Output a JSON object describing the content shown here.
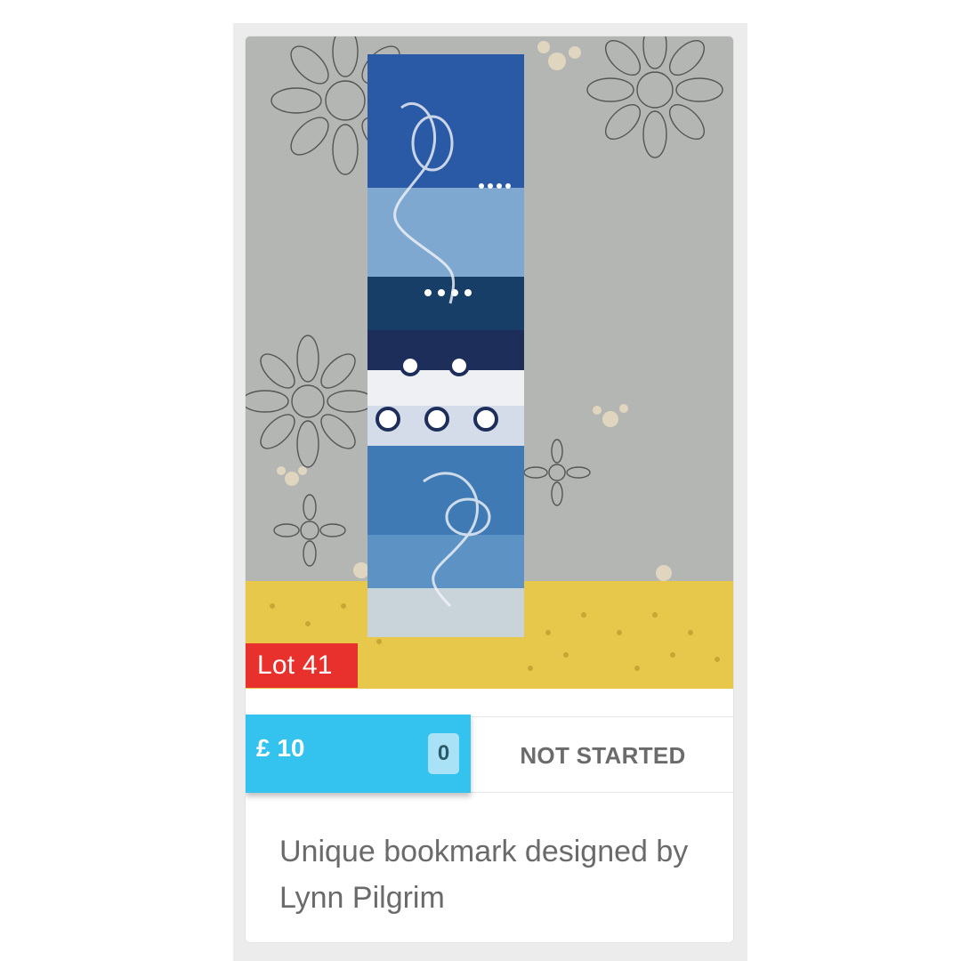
{
  "lot": {
    "label": "Lot 41"
  },
  "price": {
    "value": "£ 10"
  },
  "bids": {
    "count": "0"
  },
  "status": {
    "label": "NOT STARTED"
  },
  "item": {
    "title": "Unique bookmark designed by Lynn Pilgrim"
  },
  "colors": {
    "lot_badge": "#e8312c",
    "price_box": "#34c3ee",
    "bid_count_bg": "#a9e2f6"
  },
  "icons": {
    "photo": "bookmark-photo"
  }
}
